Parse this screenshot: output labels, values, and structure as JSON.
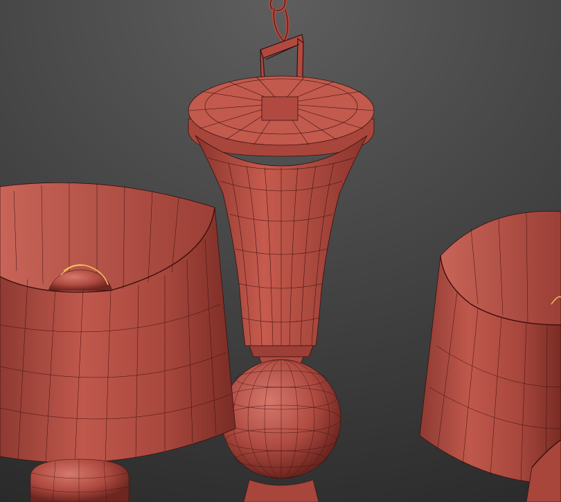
{
  "viewport": {
    "shading": "wireframe-on-shaded",
    "background_top": "#5a5a5a",
    "background_bottom": "#2b2b2b"
  },
  "colors": {
    "material": "#b04a40",
    "material_light": "#d8756a",
    "material_dark": "#7a2c25",
    "wire": "#3a0f0c",
    "bulb_filament": "#f2c15a"
  },
  "objects": [
    {
      "name": "chandelier-chain-hook",
      "icon": "hook-icon"
    },
    {
      "name": "chandelier-body",
      "icon": "vase-icon"
    },
    {
      "name": "lamp-shade-left",
      "icon": "lampshade-icon"
    },
    {
      "name": "lamp-shade-right",
      "icon": "lampshade-icon"
    },
    {
      "name": "light-bulb-left",
      "icon": "bulb-icon"
    }
  ]
}
